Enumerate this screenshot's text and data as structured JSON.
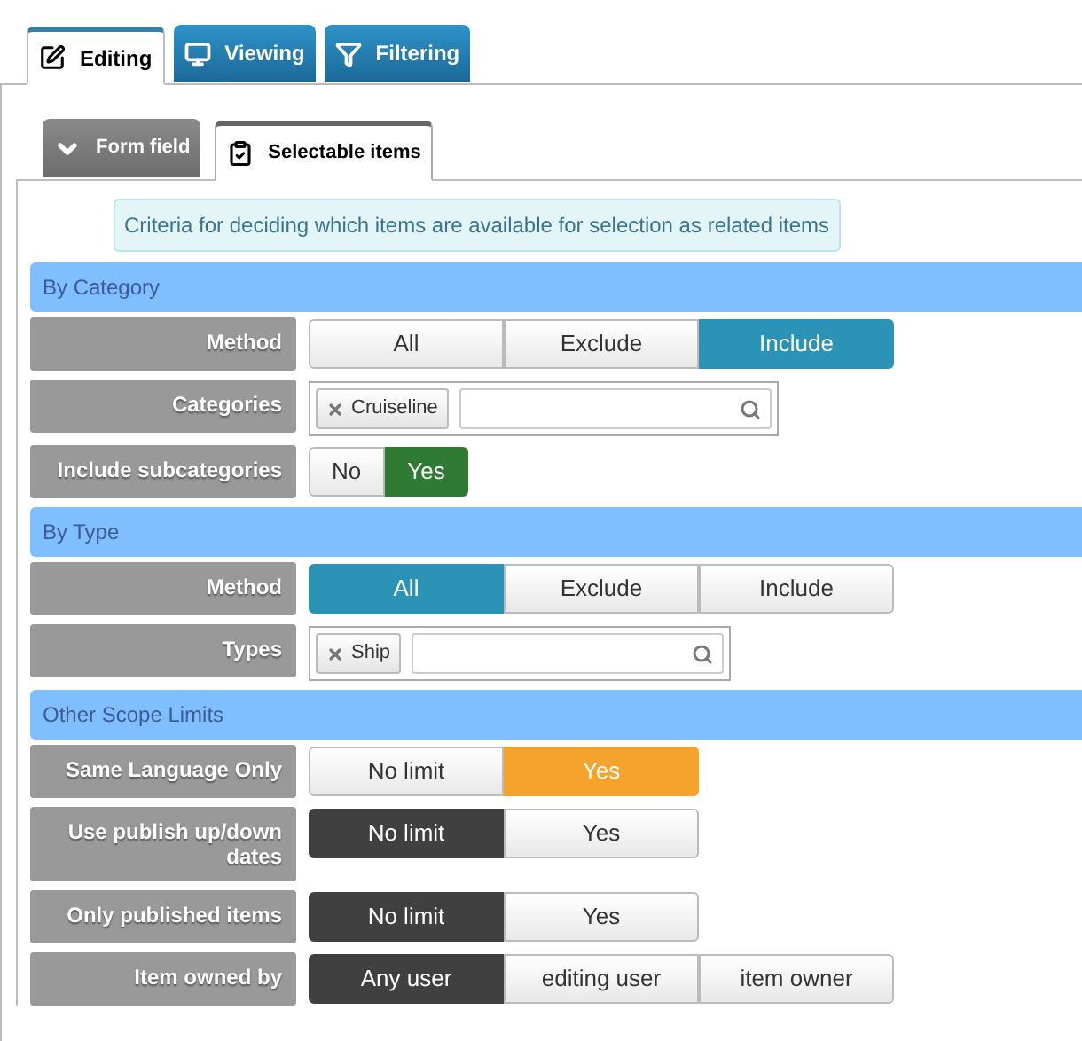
{
  "tabs": [
    {
      "label": "Editing",
      "selected": true
    },
    {
      "label": "Viewing",
      "selected": false
    },
    {
      "label": "Filtering",
      "selected": false
    }
  ],
  "subtabs": [
    {
      "label": "Form field",
      "selected": false
    },
    {
      "label": "Selectable items",
      "selected": true
    }
  ],
  "info": "Criteria for deciding which items are available for selection as related items",
  "sections": [
    {
      "title": "By Category",
      "rows": [
        {
          "kind": "segmented",
          "label": "Method",
          "color": "#2b93b5",
          "options": [
            {
              "label": "All",
              "selected": false
            },
            {
              "label": "Exclude",
              "selected": false
            },
            {
              "label": "Include",
              "selected": true
            }
          ]
        },
        {
          "kind": "tags",
          "label": "Categories",
          "tags": [
            "Cruiseline"
          ]
        },
        {
          "kind": "segmented",
          "label": "Include subcategories",
          "color": "#2f7b34",
          "narrow": true,
          "options": [
            {
              "label": "No",
              "selected": false
            },
            {
              "label": "Yes",
              "selected": true
            }
          ]
        }
      ]
    },
    {
      "title": "By Type",
      "rows": [
        {
          "kind": "segmented",
          "label": "Method",
          "color": "#2b93b5",
          "options": [
            {
              "label": "All",
              "selected": true
            },
            {
              "label": "Exclude",
              "selected": false
            },
            {
              "label": "Include",
              "selected": false
            }
          ]
        },
        {
          "kind": "tags",
          "label": "Types",
          "tags": [
            "Ship"
          ]
        }
      ]
    },
    {
      "title": "Other Scope Limits",
      "rows": [
        {
          "kind": "segmented",
          "label": "Same Language Only",
          "color": "#f6a32e",
          "options": [
            {
              "label": "No limit",
              "selected": false
            },
            {
              "label": "Yes",
              "selected": true
            }
          ]
        },
        {
          "kind": "segmented",
          "label": "Use publish up/down dates",
          "color": "#404040",
          "options": [
            {
              "label": "No limit",
              "selected": true
            },
            {
              "label": "Yes",
              "selected": false
            }
          ]
        },
        {
          "kind": "segmented",
          "label": "Only published items",
          "color": "#404040",
          "options": [
            {
              "label": "No limit",
              "selected": true
            },
            {
              "label": "Yes",
              "selected": false
            }
          ]
        },
        {
          "kind": "segmented",
          "label": "Item owned by",
          "color": "#404040",
          "options": [
            {
              "label": "Any user",
              "selected": true
            },
            {
              "label": "editing user",
              "selected": false
            },
            {
              "label": "item owner",
              "selected": false
            }
          ]
        }
      ]
    }
  ]
}
